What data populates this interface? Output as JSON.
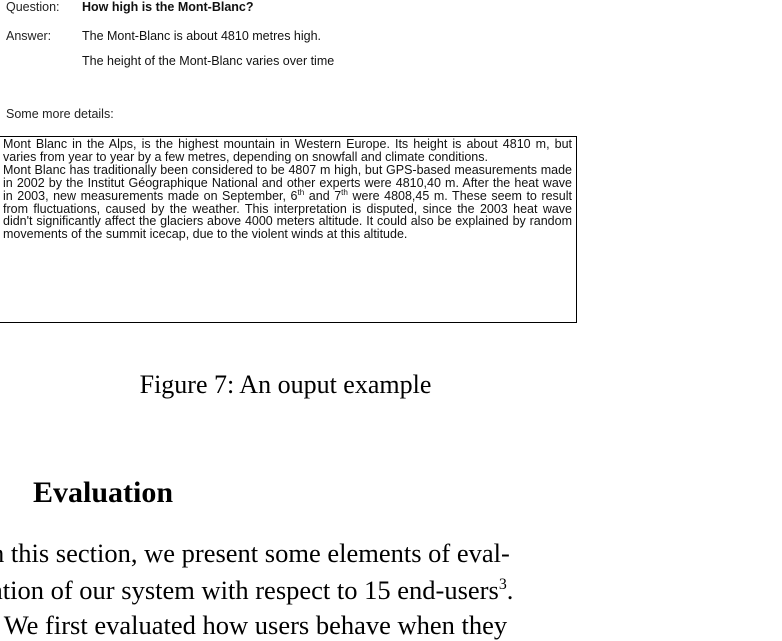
{
  "qa": {
    "question_label": "Question:",
    "question": "How high is the Mont-Blanc?",
    "answer_label": "Answer:",
    "answer_line_1": "The Mont-Blanc is about 4810 metres high.",
    "answer_line_2": "The height of the Mont-Blanc varies over time"
  },
  "details": {
    "heading": "Some more details:",
    "para_1": "Mont Blanc in the Alps, is the highest mountain in Western Europe. Its height is about 4810 m, but varies from year to year by a few metres, depending on snowfall and climate conditions.",
    "para_2_before_sup_1": "Mont Blanc has traditionally been considered to be 4807 m high, but GPS-based measurements made in 2002 by the Institut Géographique National and other experts were 4810,40 m. After the heat wave in 2003, new measurements made on September, 6",
    "sup_1": "th",
    "para_2_between": " and 7",
    "sup_2": "th",
    "para_2_after_sup_2": " were 4808,45 m. These seem to result from fluctuations, caused by the weather. This interpretation is disputed, since the 2003 heat wave didn't significantly affect the glaciers above 4000 meters altitude. It could also be explained by random movements of the summit icecap, due to the violent winds at this altitude."
  },
  "figure": {
    "caption": "Figure 7: An ouput example"
  },
  "section": {
    "heading": "Evaluation",
    "line_1": "n this section, we present some elements of eval-",
    "line_2_before_sup": "ation of our system with respect to 15 end-users",
    "line_2_sup": "3",
    "line_2_after_sup": ".",
    "line_3": ". We first evaluated how users behave when they"
  }
}
